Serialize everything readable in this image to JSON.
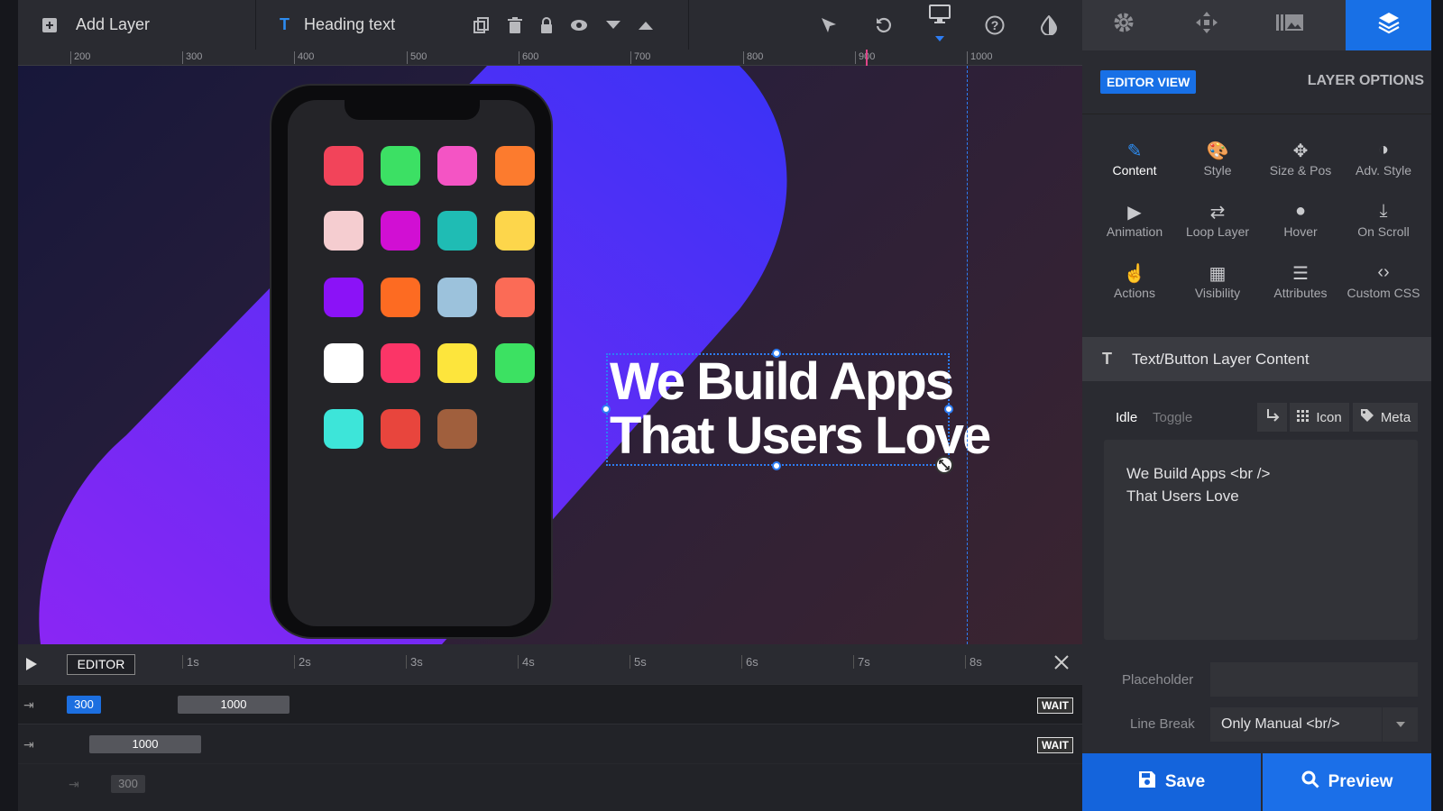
{
  "toolbar": {
    "add_layer": "Add Layer",
    "layer_name": "Heading text"
  },
  "ruler": {
    "ticks": [
      "200",
      "300",
      "400",
      "500",
      "600",
      "700",
      "800",
      "900",
      "1000"
    ]
  },
  "stage": {
    "headline_line1": "We Build Apps",
    "headline_line2": "That Users Love",
    "app_colors": [
      "#f2445a",
      "#3ce064",
      "#f454c4",
      "#fc7b2e",
      "#f5cdd0",
      "#d10fd3",
      "#1fbcb4",
      "#fdd64b",
      "#8b12f7",
      "#fd6b22",
      "#9cc2dc",
      "#fb6b56",
      "#ffffff",
      "#fb3567",
      "#fde53c",
      "#3ce162",
      "#3de5d9",
      "#e8453d",
      "#a05f3d"
    ]
  },
  "timeline": {
    "editor_label": "EDITOR",
    "seconds": [
      "1s",
      "2s",
      "3s",
      "4s",
      "5s",
      "6s",
      "7s",
      "8s"
    ],
    "row1": {
      "start": "300",
      "duration": "1000",
      "wait": "WAIT"
    },
    "row2": {
      "duration": "1000",
      "wait": "WAIT"
    },
    "row3": {
      "duration": "300"
    }
  },
  "panel": {
    "editor_view": "EDITOR VIEW",
    "layer_options": "LAYER OPTIONS",
    "grid": [
      "Content",
      "Style",
      "Size & Pos",
      "Adv. Style",
      "Animation",
      "Loop Layer",
      "Hover",
      "On Scroll",
      "Actions",
      "Visibility",
      "Attributes",
      "Custom CSS"
    ],
    "section_title": "Text/Button Layer Content",
    "state_idle": "Idle",
    "state_toggle": "Toggle",
    "icon_btn": "Icon",
    "meta_btn": "Meta",
    "content_line1": "We Build Apps <br />",
    "content_line2": "That Users Love",
    "placeholder_label": "Placeholder",
    "placeholder_value": "",
    "linebreak_label": "Line Break",
    "linebreak_value": "Only Manual <br/>",
    "save": "Save",
    "preview": "Preview"
  }
}
